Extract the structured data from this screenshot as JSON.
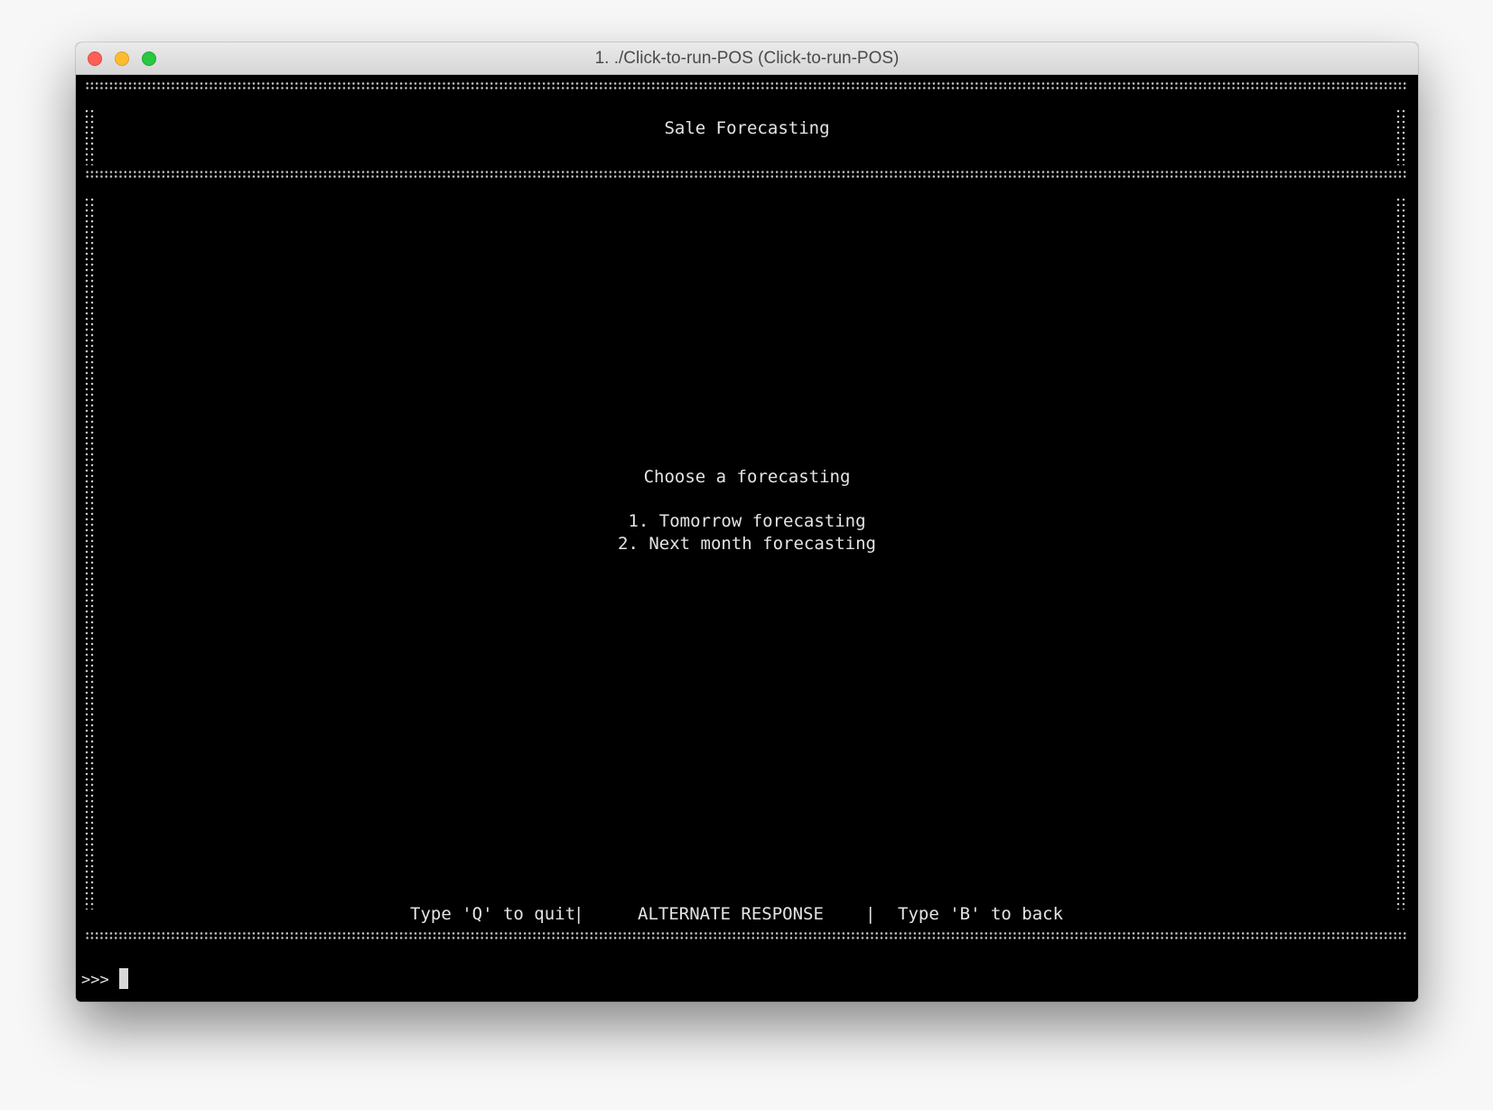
{
  "window": {
    "title": "1. ./Click-to-run-POS (Click-to-run-POS)"
  },
  "screen": {
    "header_title": "Sale Forecasting",
    "prompt_text": "Choose a forecasting",
    "options": [
      "1. Tomorrow forecasting",
      "2. Next month forecasting"
    ],
    "footer": {
      "quit_hint": "Type 'Q' to quit",
      "separator": "|",
      "mode": "ALTERNATE RESPONSE",
      "back_hint": "Type 'B' to back"
    }
  },
  "input": {
    "prompt": ">>>",
    "value": ""
  },
  "colors": {
    "terminal_background": "#000000",
    "terminal_text": "#e4e4e4",
    "close": "#fc5f57",
    "minimize": "#fdbc2e",
    "zoom": "#28c840"
  }
}
